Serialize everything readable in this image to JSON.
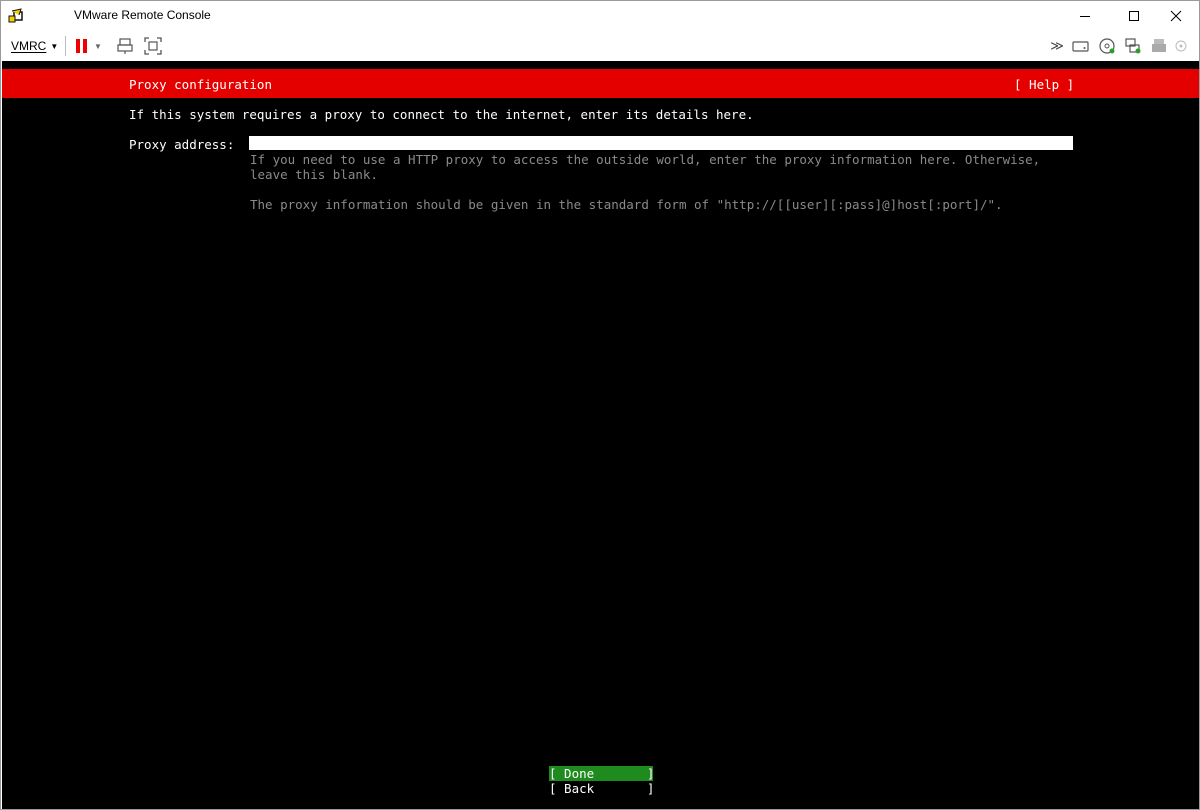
{
  "window": {
    "title": "VMware Remote Console"
  },
  "toolbar": {
    "menu_label": "VMRC"
  },
  "console": {
    "header_title": "Proxy configuration",
    "help_label": "[ Help ]",
    "intro": "If this system requires a proxy to connect to the internet, enter its details here.",
    "proxy_label": "Proxy address:",
    "proxy_value": "",
    "help_line1": "If you need to use a HTTP proxy to access the outside world, enter the proxy information here. Otherwise,",
    "help_line2": "leave this blank.",
    "help_line3": "The proxy information should be given in the standard form of \"http://[[user][:pass]@]host[:port]/\".",
    "done_label": "[ Done       ]",
    "back_label": "[ Back       ]"
  },
  "colors": {
    "header_bg": "#e50000",
    "done_bg": "#1f8b1f",
    "hint_text": "#8a8a8a"
  }
}
